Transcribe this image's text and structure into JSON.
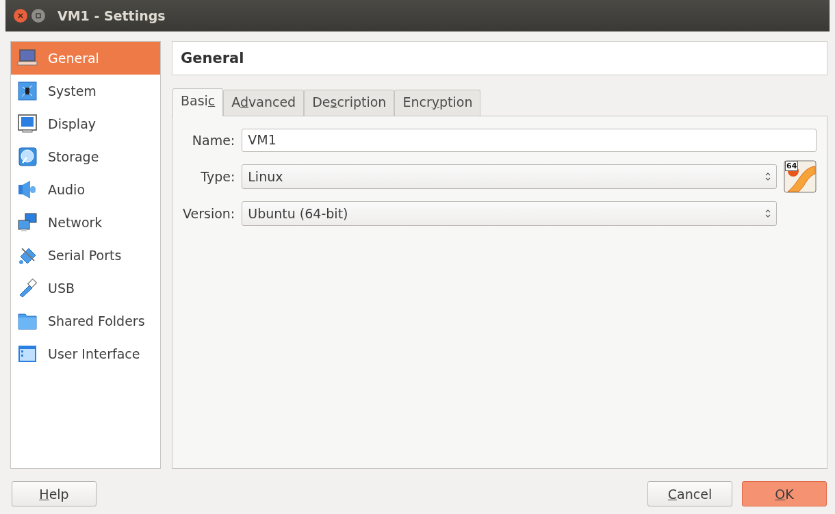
{
  "window": {
    "title": "VM1 - Settings"
  },
  "sidebar": {
    "items": [
      {
        "label": "General",
        "kind": "laptop",
        "selected": true
      },
      {
        "label": "System",
        "kind": "chip",
        "selected": false
      },
      {
        "label": "Display",
        "kind": "monitor",
        "selected": false
      },
      {
        "label": "Storage",
        "kind": "disk",
        "selected": false
      },
      {
        "label": "Audio",
        "kind": "speaker",
        "selected": false
      },
      {
        "label": "Network",
        "kind": "network",
        "selected": false
      },
      {
        "label": "Serial Ports",
        "kind": "plug",
        "selected": false
      },
      {
        "label": "USB",
        "kind": "usb",
        "selected": false
      },
      {
        "label": "Shared Folders",
        "kind": "folder",
        "selected": false
      },
      {
        "label": "User Interface",
        "kind": "window",
        "selected": false
      }
    ]
  },
  "page_title": "General",
  "tabs": [
    {
      "label": [
        {
          "text": "Basi",
          "underlined": false
        },
        {
          "text": "c",
          "underlined": true
        }
      ],
      "selected": true
    },
    {
      "label": [
        {
          "text": "A",
          "underlined": false
        },
        {
          "text": "d",
          "underlined": true
        },
        {
          "text": "vanced",
          "underlined": false
        }
      ],
      "selected": false
    },
    {
      "label": [
        {
          "text": "De",
          "underlined": false
        },
        {
          "text": "s",
          "underlined": true
        },
        {
          "text": "cription",
          "underlined": false
        }
      ],
      "selected": false
    },
    {
      "label": [
        {
          "text": "Encr",
          "underlined": false
        },
        {
          "text": "y",
          "underlined": true
        },
        {
          "text": "ption",
          "underlined": false
        }
      ],
      "selected": false
    }
  ],
  "form": [
    {
      "kind": "text",
      "label": "Name:",
      "value": "VM1"
    },
    {
      "kind": "select",
      "label": "Type:",
      "value": "Linux",
      "os_badge": "64"
    },
    {
      "kind": "select",
      "label": "Version:",
      "value": "Ubuntu (64-bit)"
    }
  ],
  "buttons_left": [
    {
      "label": [
        {
          "text": "H",
          "underlined": true
        },
        {
          "text": "elp",
          "underlined": false
        }
      ],
      "default": false
    }
  ],
  "buttons_right": [
    {
      "label": [
        {
          "text": "C",
          "underlined": true
        },
        {
          "text": "ancel",
          "underlined": false
        }
      ],
      "default": false
    },
    {
      "label": [
        {
          "text": "O",
          "underlined": true
        },
        {
          "text": "K",
          "underlined": false
        }
      ],
      "default": true
    }
  ]
}
